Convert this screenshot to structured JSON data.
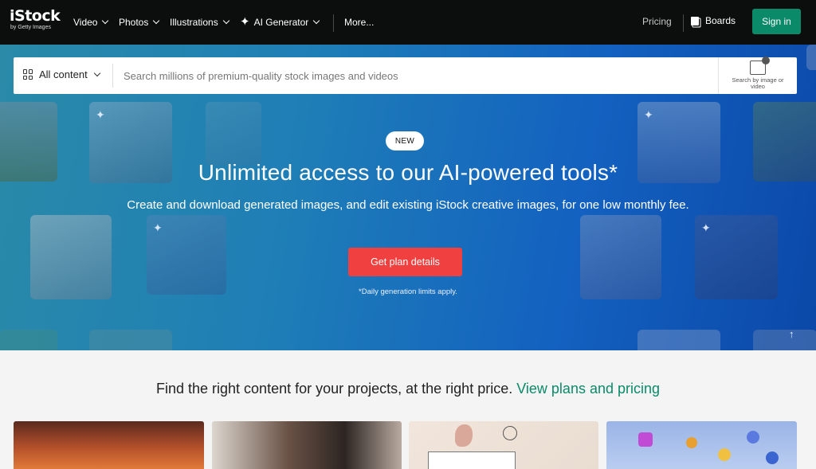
{
  "brand": {
    "name": "iStock",
    "tagline": "by Getty Images"
  },
  "nav": {
    "items": [
      {
        "label": "Video"
      },
      {
        "label": "Photos"
      },
      {
        "label": "Illustrations"
      },
      {
        "label": "AI Generator"
      }
    ],
    "more": "More...",
    "pricing": "Pricing",
    "boards": "Boards",
    "signin": "Sign in"
  },
  "search": {
    "filter_label": "All content",
    "placeholder": "Search millions of premium-quality stock images and videos",
    "image_search_label": "Search by image or video"
  },
  "hero": {
    "badge": "NEW",
    "title": "Unlimited access to our AI-powered tools*",
    "subtitle": "Create and download generated images, and edit existing iStock creative images, for one low monthly fee.",
    "cta": "Get plan details",
    "note": "*Daily generation limits apply."
  },
  "promo": {
    "text": "Find the right content for your projects, at the right price.",
    "link": "View plans and pricing"
  },
  "colors": {
    "nav_bg": "#0c0d0d",
    "signin_bg": "#0b8a6a",
    "cta_bg": "#f0403f",
    "link": "#0b8a6a"
  }
}
